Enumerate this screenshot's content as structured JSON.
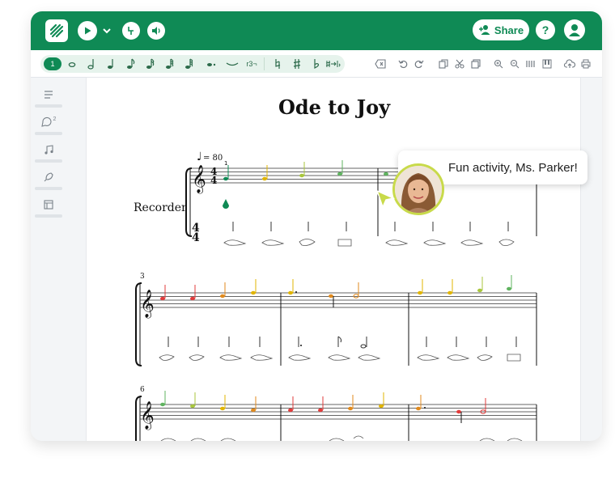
{
  "header": {
    "share_label": "Share",
    "help_label": "?",
    "icons": [
      "logo-icon",
      "play-icon",
      "chevron-down-icon",
      "tuning-icon",
      "speaker-icon",
      "add-person-icon",
      "help-icon",
      "user-icon"
    ],
    "accent": "#0f8a55"
  },
  "toolbar": {
    "voice_badge": "1",
    "tuplet_label": "r3¬"
  },
  "sidebar": {
    "comment_count": "2"
  },
  "score": {
    "title": "Ode to Joy",
    "tempo": "= 80",
    "instrument": "Recorder",
    "time_sig_top": "4",
    "time_sig_bottom": "4",
    "measure_3": "3",
    "measure_6": "6",
    "fingering_1": "1"
  },
  "comment": {
    "text": "Fun activity, Ms. Parker!"
  }
}
